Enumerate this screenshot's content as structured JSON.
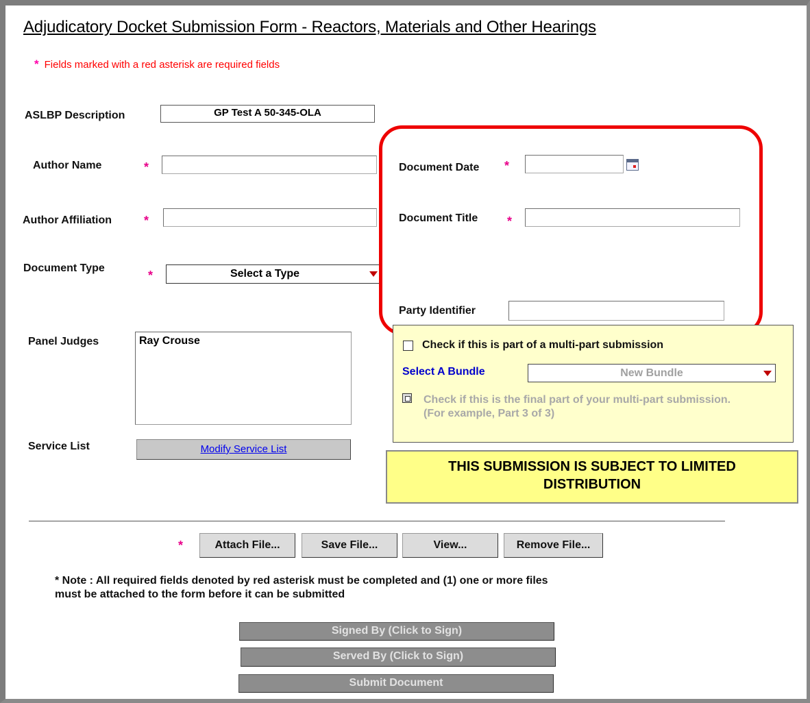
{
  "form": {
    "title": "Adjudicatory Docket Submission Form - Reactors, Materials and Other Hearings",
    "required_note": "Fields marked with a red asterisk are required  fields",
    "required_marker": "*"
  },
  "fields": {
    "aslbp_label": "ASLBP Description",
    "aslbp_value": "GP Test A 50-345-OLA",
    "author_name_label": "Author Name",
    "author_name_value": "",
    "author_affiliation_label": "Author Affiliation",
    "author_affiliation_value": "",
    "document_type_label": "Document Type",
    "document_type_value": "Select a Type",
    "document_date_label": "Document Date",
    "document_date_value": "",
    "document_title_label": "Document Title",
    "document_title_value": "",
    "party_identifier_label": "Party Identifier",
    "party_identifier_value": "",
    "panel_judges_label": "Panel Judges",
    "panel_judges": [
      "Ray Crouse"
    ],
    "service_list_label": "Service List",
    "modify_service_list": "Modify Service List"
  },
  "bundle": {
    "multipart_label": "Check if this is part of a multi-part submission",
    "select_bundle_label": "Select A Bundle",
    "bundle_value": "New Bundle",
    "final_part_line1": "Check if this is the final part of your multi-part submission.",
    "final_part_line2": "(For example, Part 3 of 3)"
  },
  "notice": {
    "line1": "THIS SUBMISSION IS SUBJECT TO LIMITED",
    "line2": "DISTRIBUTION"
  },
  "files": {
    "attach": "Attach File...",
    "save": "Save File...",
    "view": "View...",
    "remove": "Remove File..."
  },
  "note": {
    "line1": "* Note : All required fields denoted by red asterisk must be completed and (1) one or more files",
    "line2": "must be attached to the form before it can be submitted"
  },
  "actions": {
    "signed_by": "Signed By (Click to Sign)",
    "served_by": "Served By (Click to Sign)",
    "submit": "Submit Document"
  },
  "colors": {
    "required_star": "#e8008a",
    "highlight_border": "#ee0000",
    "bundle_panel": "#ffffcc",
    "limited_banner": "#ffff88",
    "bundle_label": "#0000cc"
  },
  "icons": {
    "date_picker": "calendar-icon",
    "dropdown": "dropdown-arrow-icon"
  }
}
